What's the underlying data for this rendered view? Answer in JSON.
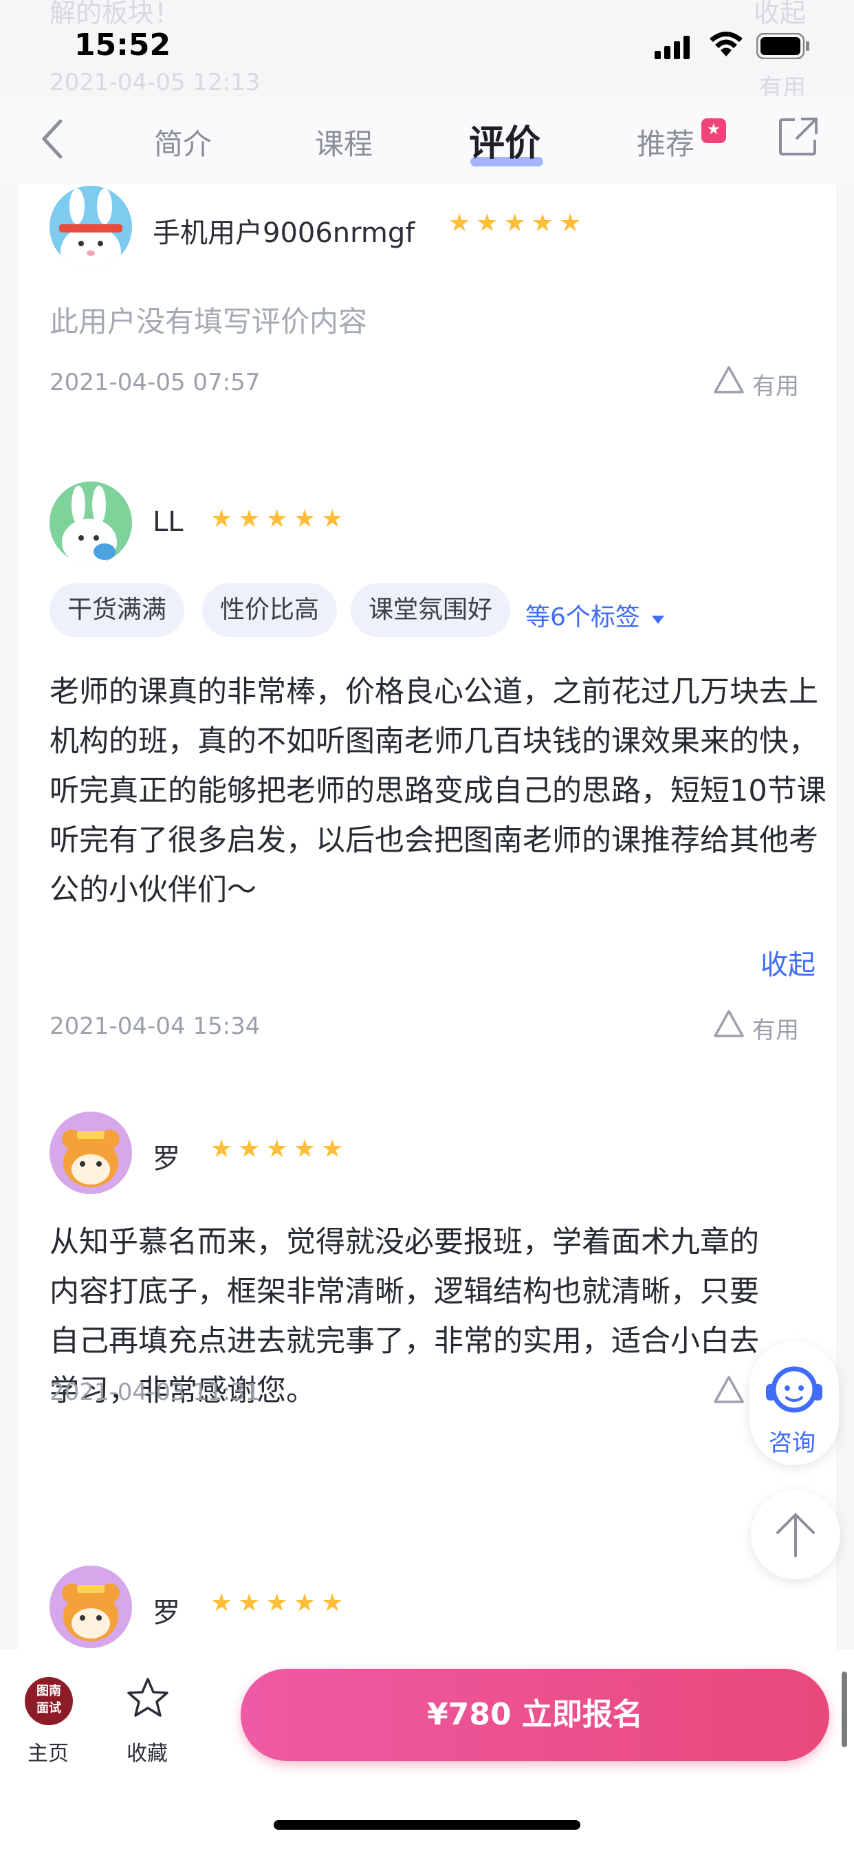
{
  "ghost": {
    "top_text": "解的板块！",
    "top_action": "收起",
    "top_date": "2021-04-05 12:13",
    "top_useful": "有用"
  },
  "status": {
    "time": "15:52"
  },
  "tabs": {
    "intro": "简介",
    "course": "课程",
    "review": "评价",
    "recommend": "推荐",
    "recommend_badge": "★"
  },
  "reviews": [
    {
      "user": "手机用户9006nrmgf",
      "stars": "★★★★★",
      "content": "此用户没有填写评价内容",
      "date": "2021-04-05 07:57",
      "useful": "有用"
    },
    {
      "user": "LL",
      "stars": "★★★★★",
      "tags": [
        "干货满满",
        "性价比高",
        "课堂氛围好"
      ],
      "more_tags": "等6个标签",
      "content": "老师的课真的非常棒，价格良心公道，之前花过几万块去上机构的班，真的不如听图南老师几百块钱的课效果来的快，听完真正的能够把老师的思路变成自己的思路，短短10节课听完有了很多启发，以后也会把图南老师的课推荐给其他考公的小伙伴们～",
      "collapse": "收起",
      "date": "2021-04-04 15:34",
      "useful": "有用"
    },
    {
      "user": "罗",
      "stars": "★★★★★",
      "content": "从知乎慕名而来，觉得就没必要报班，学着面术九章的内容打底子，框架非常清晰，逻辑结构也就清晰，只要自己再填充点进去就完事了，非常的实用，适合小白去学习，非常感谢您。",
      "date": "2021-04-03 11:31",
      "useful": "有用"
    },
    {
      "user": "罗",
      "stars": "★★★★★"
    }
  ],
  "floating": {
    "consult": "咨询"
  },
  "bottom": {
    "home_logo": "图南面试",
    "home": "主页",
    "favorite": "收藏",
    "enroll": "¥780  立即报名"
  },
  "colors": {
    "accent": "#3f6df7",
    "star": "#ffbe3a",
    "cta_start": "#ee5aa4",
    "cta_end": "#e9487a"
  }
}
